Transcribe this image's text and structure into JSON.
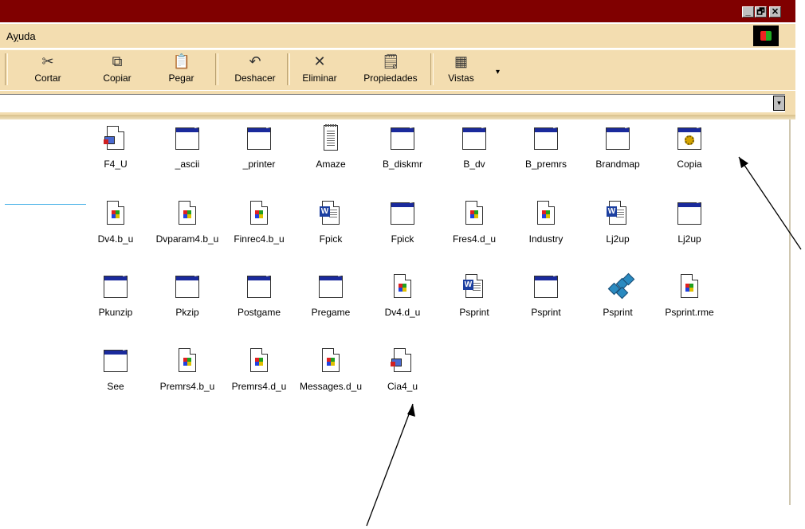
{
  "window": {
    "minimize_label": "_",
    "maximize_label": "🗗",
    "close_label": "✕"
  },
  "menu": {
    "items": [
      {
        "label": "Ayuda",
        "underline": "y"
      }
    ],
    "logo_icon": "windows-logo-icon"
  },
  "toolbar": {
    "buttons": [
      {
        "label": "Cortar",
        "icon": "scissors-icon",
        "glyph": "✂"
      },
      {
        "label": "Copiar",
        "icon": "copy-icon",
        "glyph": "⧉"
      },
      {
        "label": "Pegar",
        "icon": "paste-icon",
        "glyph": "📋"
      },
      {
        "label": "Deshacer",
        "icon": "undo-icon",
        "glyph": "↶"
      },
      {
        "label": "Eliminar",
        "icon": "delete-icon",
        "glyph": "✕"
      },
      {
        "label": "Propiedades",
        "icon": "properties-icon",
        "glyph": "🗒"
      },
      {
        "label": "Vistas",
        "icon": "views-icon",
        "glyph": "▦"
      }
    ],
    "more_glyph": "▾"
  },
  "address": {
    "value": "",
    "dropdown_glyph": "▾"
  },
  "files": [
    {
      "name": "F4_U",
      "type": "shortcut-doc"
    },
    {
      "name": "_ascii",
      "type": "window"
    },
    {
      "name": "_printer",
      "type": "window"
    },
    {
      "name": "Amaze",
      "type": "notepad"
    },
    {
      "name": "B_diskmr",
      "type": "window"
    },
    {
      "name": "B_dv",
      "type": "window"
    },
    {
      "name": "B_premrs",
      "type": "window"
    },
    {
      "name": "Brandmap",
      "type": "window"
    },
    {
      "name": "Copia",
      "type": "window-gear"
    },
    {
      "name": "Dv4.b_u",
      "type": "windows-doc"
    },
    {
      "name": "Dvparam4.b_u",
      "type": "windows-doc"
    },
    {
      "name": "Finrec4.b_u",
      "type": "windows-doc"
    },
    {
      "name": "Fpick",
      "type": "word-doc"
    },
    {
      "name": "Fpick",
      "type": "window"
    },
    {
      "name": "Fres4.d_u",
      "type": "windows-doc"
    },
    {
      "name": "Industry",
      "type": "windows-doc"
    },
    {
      "name": "Lj2up",
      "type": "word-doc"
    },
    {
      "name": "Lj2up",
      "type": "window"
    },
    {
      "name": "Pkunzip",
      "type": "window"
    },
    {
      "name": "Pkzip",
      "type": "window"
    },
    {
      "name": "Postgame",
      "type": "window"
    },
    {
      "name": "Pregame",
      "type": "window"
    },
    {
      "name": "Dv4.d_u",
      "type": "windows-doc"
    },
    {
      "name": "Psprint",
      "type": "word-doc"
    },
    {
      "name": "Psprint",
      "type": "window"
    },
    {
      "name": "Psprint",
      "type": "registry"
    },
    {
      "name": "Psprint.rme",
      "type": "windows-doc"
    },
    {
      "name": "See",
      "type": "window"
    },
    {
      "name": "Premrs4.b_u",
      "type": "windows-doc"
    },
    {
      "name": "Premrs4.d_u",
      "type": "windows-doc"
    },
    {
      "name": "Messages.d_u",
      "type": "windows-doc"
    },
    {
      "name": "Cia4_u",
      "type": "shortcut-doc"
    }
  ]
}
